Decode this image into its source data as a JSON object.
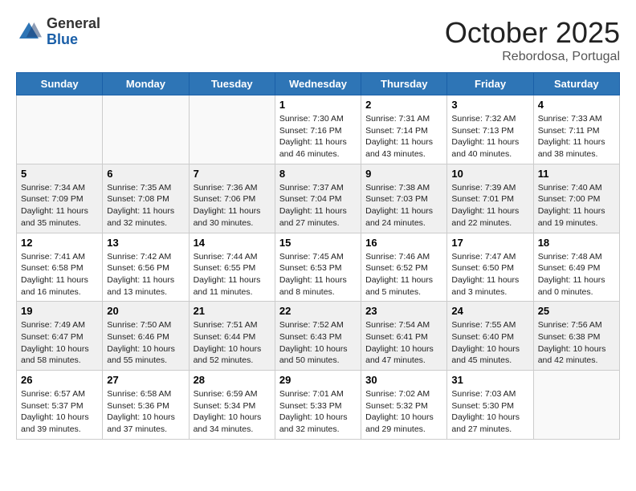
{
  "header": {
    "logo_general": "General",
    "logo_blue": "Blue",
    "month": "October 2025",
    "location": "Rebordosa, Portugal"
  },
  "weekdays": [
    "Sunday",
    "Monday",
    "Tuesday",
    "Wednesday",
    "Thursday",
    "Friday",
    "Saturday"
  ],
  "weeks": [
    [
      {
        "day": "",
        "info": ""
      },
      {
        "day": "",
        "info": ""
      },
      {
        "day": "",
        "info": ""
      },
      {
        "day": "1",
        "info": "Sunrise: 7:30 AM\nSunset: 7:16 PM\nDaylight: 11 hours\nand 46 minutes."
      },
      {
        "day": "2",
        "info": "Sunrise: 7:31 AM\nSunset: 7:14 PM\nDaylight: 11 hours\nand 43 minutes."
      },
      {
        "day": "3",
        "info": "Sunrise: 7:32 AM\nSunset: 7:13 PM\nDaylight: 11 hours\nand 40 minutes."
      },
      {
        "day": "4",
        "info": "Sunrise: 7:33 AM\nSunset: 7:11 PM\nDaylight: 11 hours\nand 38 minutes."
      }
    ],
    [
      {
        "day": "5",
        "info": "Sunrise: 7:34 AM\nSunset: 7:09 PM\nDaylight: 11 hours\nand 35 minutes."
      },
      {
        "day": "6",
        "info": "Sunrise: 7:35 AM\nSunset: 7:08 PM\nDaylight: 11 hours\nand 32 minutes."
      },
      {
        "day": "7",
        "info": "Sunrise: 7:36 AM\nSunset: 7:06 PM\nDaylight: 11 hours\nand 30 minutes."
      },
      {
        "day": "8",
        "info": "Sunrise: 7:37 AM\nSunset: 7:04 PM\nDaylight: 11 hours\nand 27 minutes."
      },
      {
        "day": "9",
        "info": "Sunrise: 7:38 AM\nSunset: 7:03 PM\nDaylight: 11 hours\nand 24 minutes."
      },
      {
        "day": "10",
        "info": "Sunrise: 7:39 AM\nSunset: 7:01 PM\nDaylight: 11 hours\nand 22 minutes."
      },
      {
        "day": "11",
        "info": "Sunrise: 7:40 AM\nSunset: 7:00 PM\nDaylight: 11 hours\nand 19 minutes."
      }
    ],
    [
      {
        "day": "12",
        "info": "Sunrise: 7:41 AM\nSunset: 6:58 PM\nDaylight: 11 hours\nand 16 minutes."
      },
      {
        "day": "13",
        "info": "Sunrise: 7:42 AM\nSunset: 6:56 PM\nDaylight: 11 hours\nand 13 minutes."
      },
      {
        "day": "14",
        "info": "Sunrise: 7:44 AM\nSunset: 6:55 PM\nDaylight: 11 hours\nand 11 minutes."
      },
      {
        "day": "15",
        "info": "Sunrise: 7:45 AM\nSunset: 6:53 PM\nDaylight: 11 hours\nand 8 minutes."
      },
      {
        "day": "16",
        "info": "Sunrise: 7:46 AM\nSunset: 6:52 PM\nDaylight: 11 hours\nand 5 minutes."
      },
      {
        "day": "17",
        "info": "Sunrise: 7:47 AM\nSunset: 6:50 PM\nDaylight: 11 hours\nand 3 minutes."
      },
      {
        "day": "18",
        "info": "Sunrise: 7:48 AM\nSunset: 6:49 PM\nDaylight: 11 hours\nand 0 minutes."
      }
    ],
    [
      {
        "day": "19",
        "info": "Sunrise: 7:49 AM\nSunset: 6:47 PM\nDaylight: 10 hours\nand 58 minutes."
      },
      {
        "day": "20",
        "info": "Sunrise: 7:50 AM\nSunset: 6:46 PM\nDaylight: 10 hours\nand 55 minutes."
      },
      {
        "day": "21",
        "info": "Sunrise: 7:51 AM\nSunset: 6:44 PM\nDaylight: 10 hours\nand 52 minutes."
      },
      {
        "day": "22",
        "info": "Sunrise: 7:52 AM\nSunset: 6:43 PM\nDaylight: 10 hours\nand 50 minutes."
      },
      {
        "day": "23",
        "info": "Sunrise: 7:54 AM\nSunset: 6:41 PM\nDaylight: 10 hours\nand 47 minutes."
      },
      {
        "day": "24",
        "info": "Sunrise: 7:55 AM\nSunset: 6:40 PM\nDaylight: 10 hours\nand 45 minutes."
      },
      {
        "day": "25",
        "info": "Sunrise: 7:56 AM\nSunset: 6:38 PM\nDaylight: 10 hours\nand 42 minutes."
      }
    ],
    [
      {
        "day": "26",
        "info": "Sunrise: 6:57 AM\nSunset: 5:37 PM\nDaylight: 10 hours\nand 39 minutes."
      },
      {
        "day": "27",
        "info": "Sunrise: 6:58 AM\nSunset: 5:36 PM\nDaylight: 10 hours\nand 37 minutes."
      },
      {
        "day": "28",
        "info": "Sunrise: 6:59 AM\nSunset: 5:34 PM\nDaylight: 10 hours\nand 34 minutes."
      },
      {
        "day": "29",
        "info": "Sunrise: 7:01 AM\nSunset: 5:33 PM\nDaylight: 10 hours\nand 32 minutes."
      },
      {
        "day": "30",
        "info": "Sunrise: 7:02 AM\nSunset: 5:32 PM\nDaylight: 10 hours\nand 29 minutes."
      },
      {
        "day": "31",
        "info": "Sunrise: 7:03 AM\nSunset: 5:30 PM\nDaylight: 10 hours\nand 27 minutes."
      },
      {
        "day": "",
        "info": ""
      }
    ]
  ]
}
